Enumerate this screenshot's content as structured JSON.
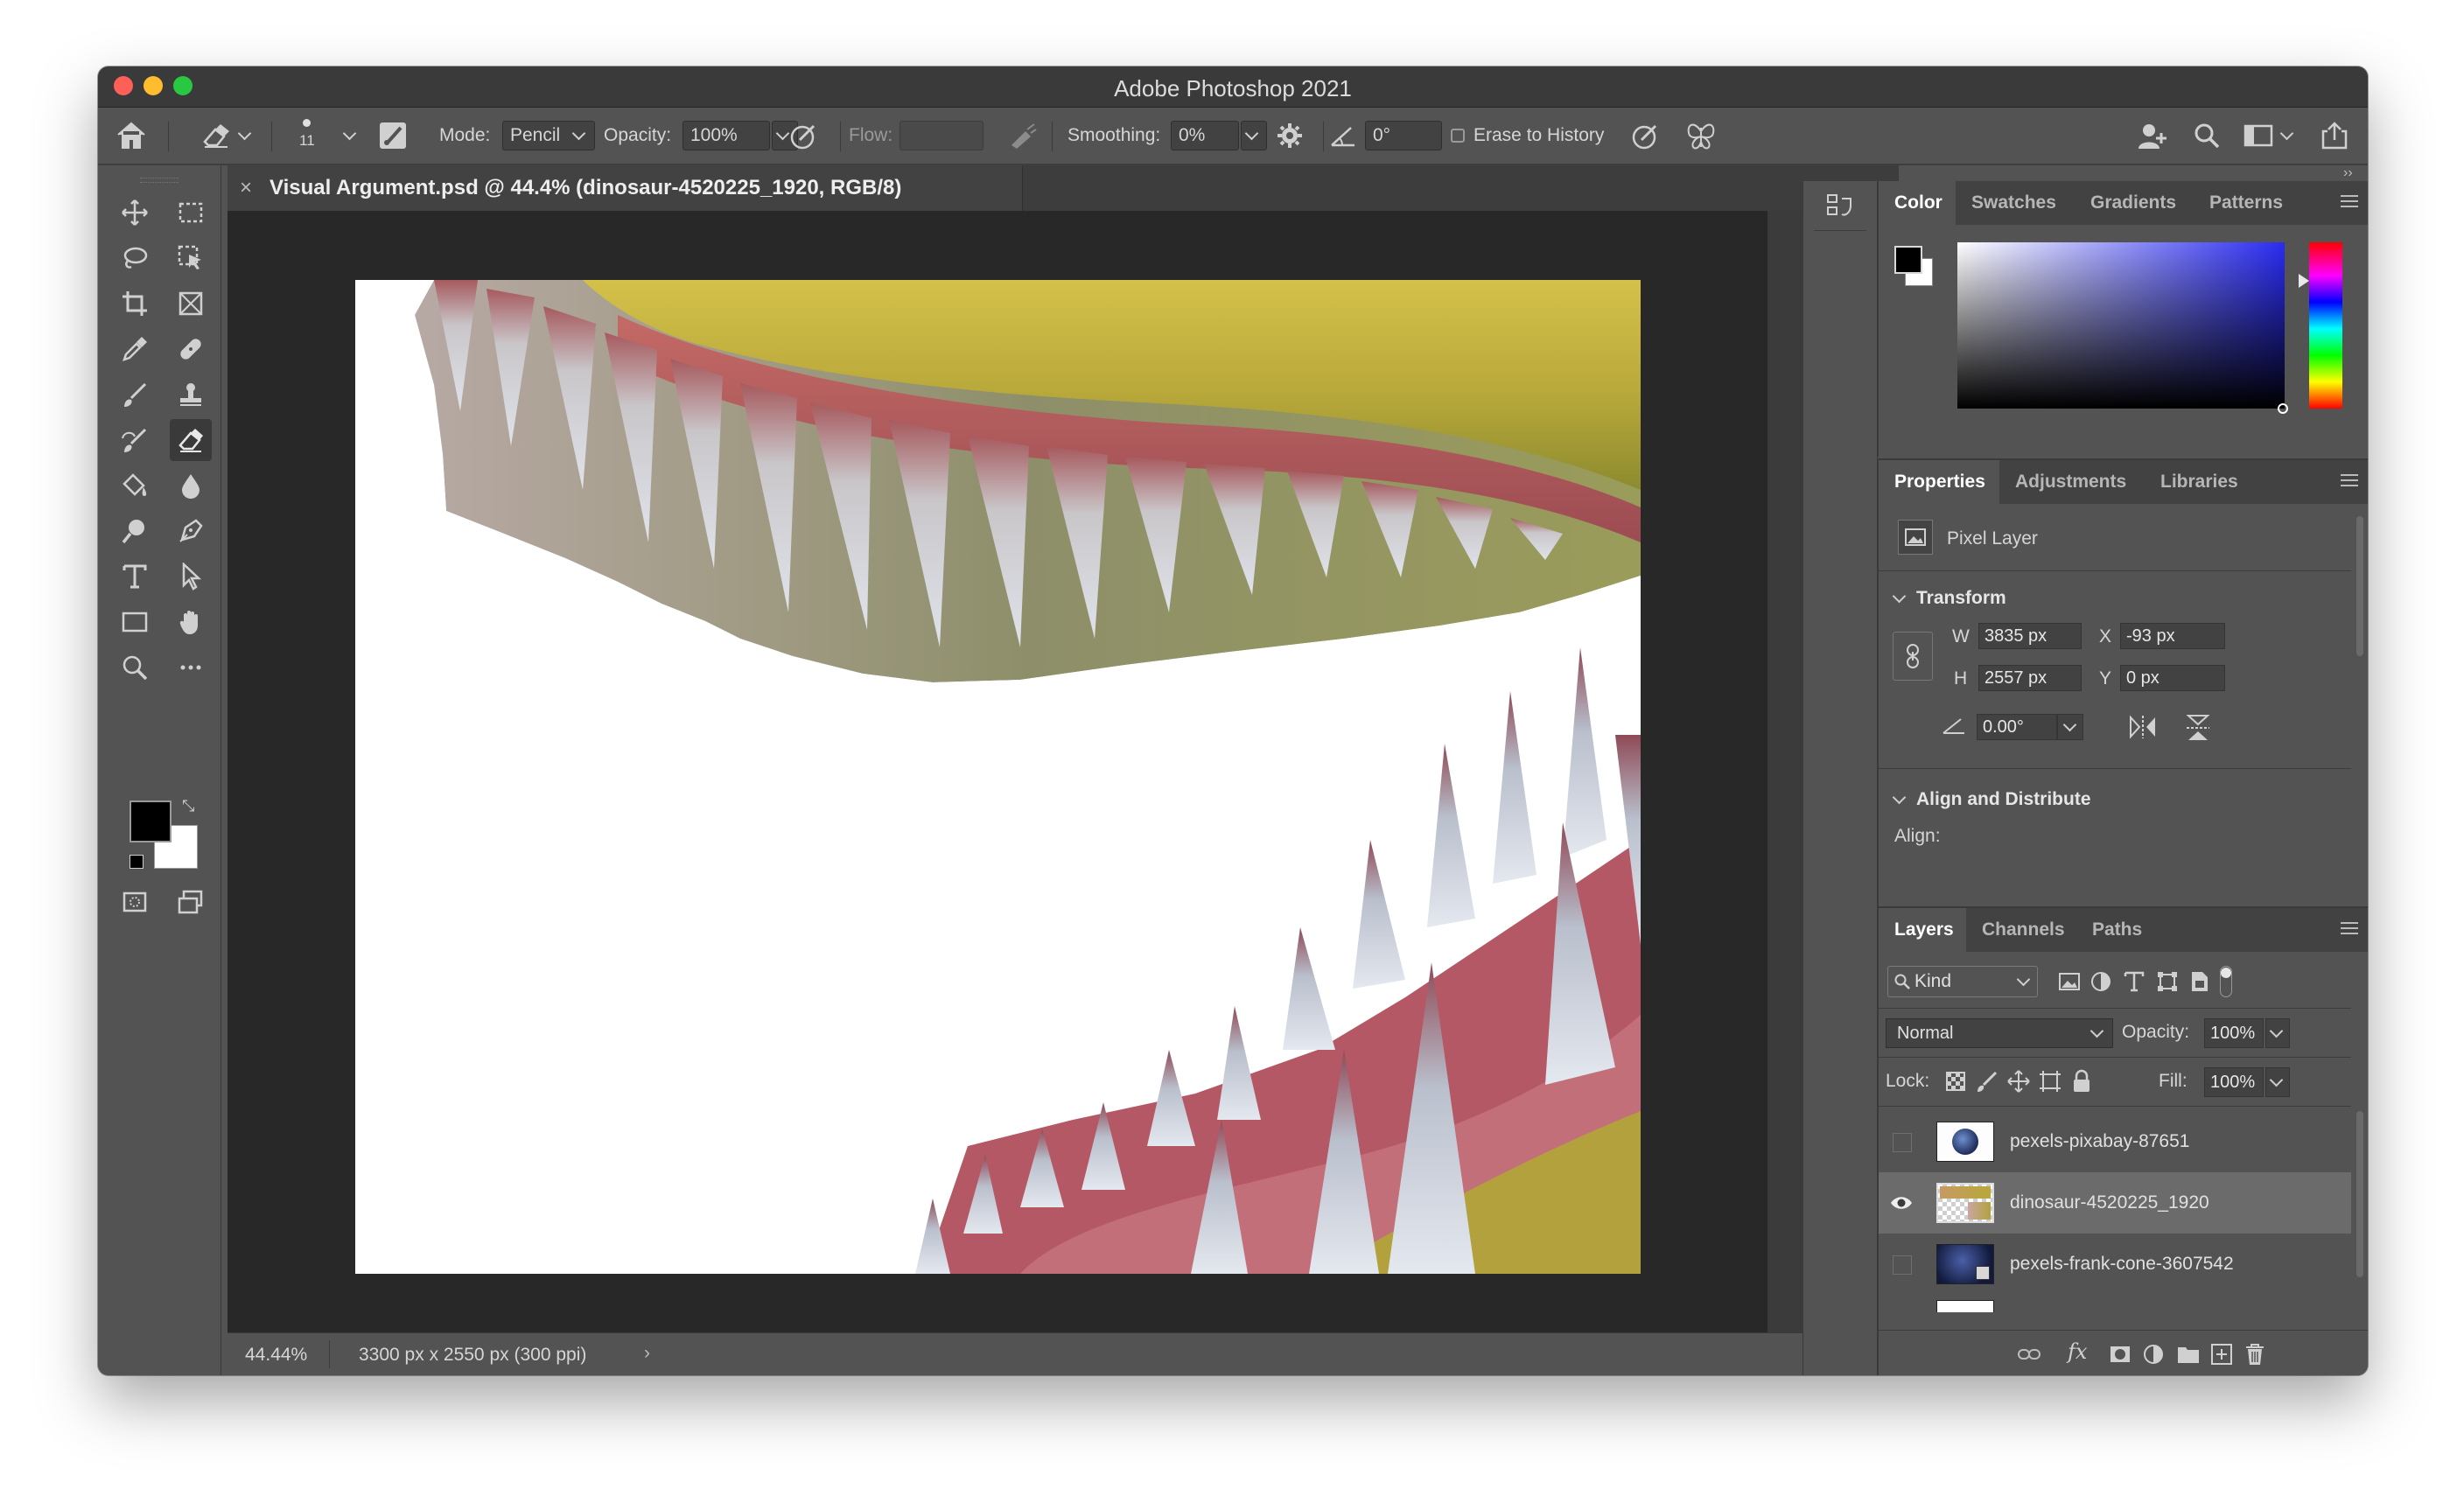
{
  "app": {
    "title": "Adobe Photoshop 2021"
  },
  "options_bar": {
    "brush_size": "11",
    "mode_label": "Mode:",
    "mode_value": "Pencil",
    "opacity_label": "Opacity:",
    "opacity_value": "100%",
    "flow_label": "Flow:",
    "flow_value": "",
    "smoothing_label": "Smoothing:",
    "smoothing_value": "0%",
    "angle_value": "0°",
    "erase_to_history_label": "Erase to History"
  },
  "document": {
    "tab_title": "Visual Argument.psd @ 44.4% (dinosaur-4520225_1920, RGB/8)",
    "zoom": "44.44%",
    "doc_info": "3300 px x 2550 px (300 ppi)"
  },
  "color_panel": {
    "tabs": [
      "Color",
      "Swatches",
      "Gradients",
      "Patterns"
    ],
    "active_tab": "Color",
    "foreground": "#000000",
    "background": "#ffffff"
  },
  "properties_panel": {
    "tabs": [
      "Properties",
      "Adjustments",
      "Libraries"
    ],
    "active_tab": "Properties",
    "layer_type": "Pixel Layer",
    "transform_header": "Transform",
    "w_label": "W",
    "w_value": "3835 px",
    "h_label": "H",
    "h_value": "2557 px",
    "x_label": "X",
    "x_value": "-93 px",
    "y_label": "Y",
    "y_value": "0 px",
    "angle_value": "0.00°",
    "align_header": "Align and Distribute",
    "align_label": "Align:"
  },
  "layers_panel": {
    "tabs": [
      "Layers",
      "Channels",
      "Paths"
    ],
    "active_tab": "Layers",
    "filter_kind": "Kind",
    "blend_mode": "Normal",
    "opacity_label": "Opacity:",
    "opacity_value": "100%",
    "lock_label": "Lock:",
    "fill_label": "Fill:",
    "fill_value": "100%",
    "layers": [
      {
        "name": "pexels-pixabay-87651",
        "visible": false,
        "selected": false
      },
      {
        "name": "dinosaur-4520225_1920",
        "visible": true,
        "selected": true
      },
      {
        "name": "pexels-frank-cone-3607542",
        "visible": false,
        "selected": false
      }
    ]
  },
  "colors": {
    "ui_bg": "#535353",
    "pasteboard": "#282828",
    "selected_layer": "#6b6b6b"
  }
}
